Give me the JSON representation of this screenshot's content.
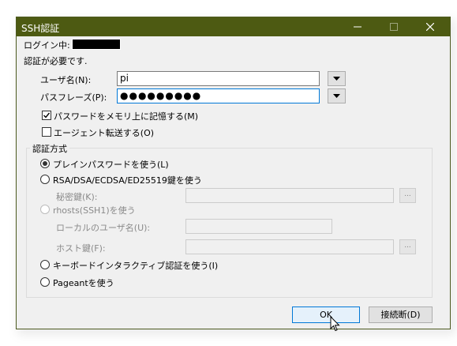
{
  "window": {
    "title": "SSH認証",
    "controls": {
      "minimize": "—",
      "maximize": "☐",
      "close": "✕"
    }
  },
  "login": {
    "label": "ログイン中:"
  },
  "auth_required": "認証が必要です.",
  "username": {
    "label": "ユーザ名(N):",
    "value": "pi"
  },
  "passphrase": {
    "label": "パスフレーズ(P):",
    "value": "●●●●●●●●●"
  },
  "options": {
    "remember_password": {
      "label": "パスワードをメモリ上に記憶する(M)",
      "checked": true
    },
    "agent_forwarding": {
      "label": "エージェント転送する(O)",
      "checked": false
    }
  },
  "auth_method": {
    "title": "認証方式",
    "plain_password": {
      "label": "プレインパスワードを使う(L)",
      "selected": true
    },
    "rsa_dsa": {
      "label": "RSA/DSA/ECDSA/ED25519鍵を使う",
      "selected": false
    },
    "private_key": {
      "label": "秘密鍵(K):",
      "browse": "..."
    },
    "rhosts": {
      "label": "rhosts(SSH1)を使う",
      "selected": false
    },
    "local_user": {
      "label": "ローカルのユーザ名(U):"
    },
    "host_key": {
      "label": "ホスト鍵(F):",
      "browse": "..."
    },
    "keyboard_interactive": {
      "label": "キーボードインタラクティブ認証を使う(I)",
      "selected": false
    },
    "pageant": {
      "label": "Pageantを使う",
      "selected": false
    }
  },
  "buttons": {
    "ok": "OK",
    "disconnect": "接続断(D)"
  },
  "colors": {
    "titlebar": "#4d5a12",
    "focus": "#0078d7",
    "window_bg": "#f0f0f0"
  }
}
